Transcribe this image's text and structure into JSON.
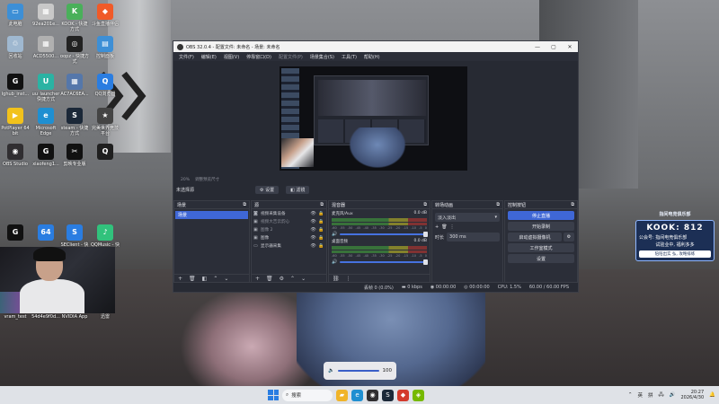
{
  "desktop": {
    "icons": [
      {
        "label": "此电脑",
        "color": "#3d8fd6",
        "glyph": "▭"
      },
      {
        "label": "92ea201e...",
        "color": "#c8c8c8",
        "glyph": "▦"
      },
      {
        "label": "KOOK - 快捷方式",
        "color": "#49b05a",
        "glyph": "K"
      },
      {
        "label": "斗鱼直播伴侣",
        "color": "#f05a28",
        "glyph": "◆"
      },
      {
        "label": "回收站",
        "color": "#9fb8d0",
        "glyph": "♲"
      },
      {
        "label": "ACD5500...",
        "color": "#b0b0b0",
        "glyph": "▦"
      },
      {
        "label": "oopz - 快捷方式",
        "color": "#222222",
        "glyph": "◎"
      },
      {
        "label": "控制面板",
        "color": "#3d8fd6",
        "glyph": "▤"
      },
      {
        "label": "lghub_inst...",
        "color": "#111111",
        "glyph": "G"
      },
      {
        "label": "uu_launcher 快捷方式",
        "color": "#2bb3a3",
        "glyph": "U"
      },
      {
        "label": "AC7AC6EA...",
        "color": "#5577aa",
        "glyph": "▦"
      },
      {
        "label": "QQ浏览器",
        "color": "#2a7de1",
        "glyph": "Q"
      },
      {
        "label": "PotPlayer 64 bit",
        "color": "#f2c21b",
        "glyph": "▶"
      },
      {
        "label": "Microsoft Edge",
        "color": "#1f8fd1",
        "glyph": "e"
      },
      {
        "label": "steam - 快捷方式",
        "color": "#1b2838",
        "glyph": "S"
      },
      {
        "label": "完美世界竞技平台",
        "color": "#444444",
        "glyph": "★"
      },
      {
        "label": "OBS Studio",
        "color": "#302e31",
        "glyph": "◉"
      },
      {
        "label": "xiaofeng1...",
        "color": "#111111",
        "glyph": "G"
      },
      {
        "label": "剪映专业版",
        "color": "#111111",
        "glyph": "✂"
      },
      {
        "label": "",
        "color": "#1f1f1f",
        "glyph": "Q"
      },
      {
        "label": "",
        "color": "#111111",
        "glyph": "G"
      },
      {
        "label": "",
        "color": "#2a7de1",
        "glyph": "64"
      },
      {
        "label": "SEClient - 快捷方式",
        "color": "#2a7de1",
        "glyph": "S"
      },
      {
        "label": "QQMusic - 快捷方式",
        "color": "#31c27c",
        "glyph": "♪"
      },
      {
        "label": "vram_test",
        "color": "#333333",
        "glyph": "▢"
      },
      {
        "label": "54d4e9f0d...",
        "color": "#777777",
        "glyph": "▦"
      },
      {
        "label": "NVIDIA App",
        "color": "#76b900",
        "glyph": "N"
      },
      {
        "label": "迅雷",
        "color": "#2a7de1",
        "glyph": "✈"
      }
    ]
  },
  "obs": {
    "title": "OBS 32.0.4 - 配置文件: 未命名 - 场景: 未命名",
    "window_controls": [
      "—",
      "▢",
      "✕"
    ],
    "menu": [
      "文件(F)",
      "编辑(E)",
      "视图(V)",
      "停靠窗口(D)",
      "配置文件(P)",
      "场景集合(S)",
      "工具(T)",
      "帮助(H)"
    ],
    "preview_bar": [
      "20%",
      "调整预览尺寸"
    ],
    "no_source": "未选择源",
    "props_button": "设置",
    "filters_button": "滤镜",
    "docks": {
      "scenes": {
        "title": "场景",
        "items": [
          "场景"
        ]
      },
      "sources": {
        "title": "源",
        "items": [
          {
            "icon": "camera-icon",
            "glyph": "◙",
            "label": "视频采集设备",
            "dim": false
          },
          {
            "icon": "image-icon",
            "glyph": "▣",
            "label": "视频大吉云韵心",
            "dim": true
          },
          {
            "icon": "image-icon",
            "glyph": "▣",
            "label": "图像 2",
            "dim": true
          },
          {
            "icon": "image-icon",
            "glyph": "▣",
            "label": "图像",
            "dim": false
          },
          {
            "icon": "monitor-icon",
            "glyph": "▭",
            "label": "显示器采集",
            "dim": false
          }
        ]
      },
      "mixer": {
        "title": "混音器",
        "channels": [
          {
            "name": "麦克风/Aux",
            "db": "0.0 dB"
          },
          {
            "name": "桌面音频",
            "db": "0.0 dB"
          }
        ],
        "scale": [
          "-60",
          "-55",
          "-50",
          "-45",
          "-40",
          "-35",
          "-30",
          "-25",
          "-20",
          "-15",
          "-10",
          "-5",
          "0"
        ]
      },
      "transitions": {
        "title": "转场动画",
        "type": "淡入淡出",
        "duration_label": "时长",
        "duration": "300 ms"
      },
      "controls": {
        "title": "控制按钮",
        "buttons": [
          "停止直播",
          "开始录制",
          "启动虚拟摄像机",
          "工作室模式",
          "设置"
        ]
      }
    },
    "status": {
      "dropped": "丢帧 0 (0.0%)",
      "kbps": "0 kbps",
      "live_time": "00:00:00",
      "rec_time": "00:00:00",
      "cpu": "CPU: 1.5%",
      "fps": "60.00 / 60.00 FPS"
    }
  },
  "kook": {
    "header": "指间电竞俱乐部",
    "number_line": "KOOK: 812",
    "line2": "公会号: 指间电竞俱乐部",
    "line3": "试验业中, 福利多多",
    "line4": "陪陪出实 弘, 攻略排练"
  },
  "volume": {
    "value": "100"
  },
  "taskbar": {
    "search": "搜索",
    "ime": [
      "英",
      "拼"
    ],
    "time": "20:27",
    "date": "2026/4/30"
  },
  "colors": {
    "obs_bg": "#272a33",
    "accent_blue": "#3f67d6",
    "taskbar_bg": "#dfe2e7"
  }
}
